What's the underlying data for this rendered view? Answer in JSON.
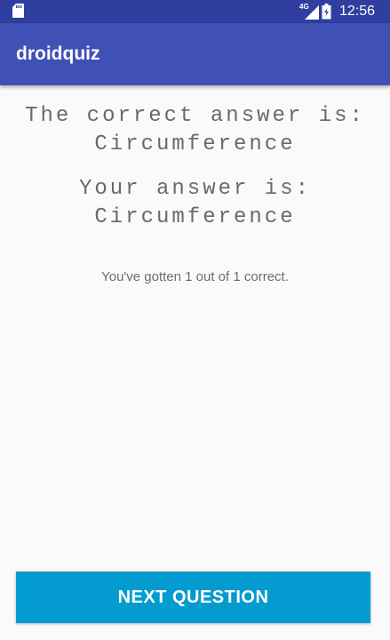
{
  "status_bar": {
    "time": "12:56",
    "network_type": "4G",
    "icons": [
      "sd-card-icon",
      "signal-icon",
      "battery-icon"
    ]
  },
  "app_bar": {
    "title": "droidquiz"
  },
  "result": {
    "correct_label": "The correct answer is:",
    "correct_answer": "Circumference",
    "user_label": "Your answer is:",
    "user_answer": "Circumference",
    "score_text": "You've gotten 1 out of 1 correct."
  },
  "actions": {
    "next_label": "NEXT QUESTION"
  },
  "colors": {
    "status_bar": "#303f9f",
    "app_bar": "#3f51b5",
    "button": "#039bd0",
    "background": "#fafafa"
  }
}
